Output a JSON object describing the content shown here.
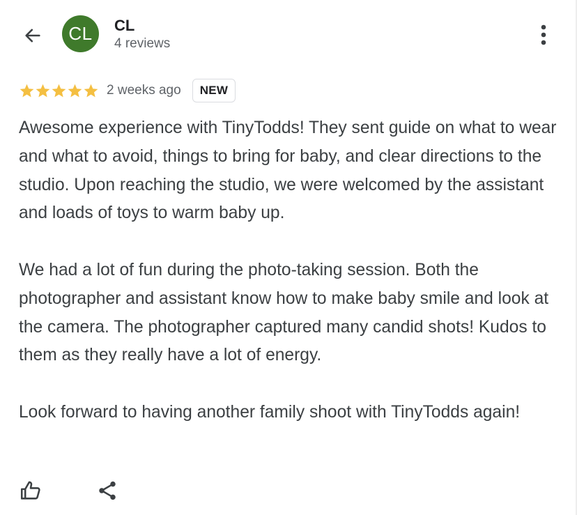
{
  "header": {
    "back_icon": "arrow-left-icon",
    "avatar_initials": "CL",
    "reviewer_name": "CL",
    "review_count": "4 reviews",
    "more_icon": "more-vertical-icon"
  },
  "review": {
    "rating": 5,
    "rating_max": 5,
    "date": "2 weeks ago",
    "badge": "NEW",
    "paragraphs": [
      "Awesome experience with TinyTodds! They sent guide on what to wear and what to avoid, things to bring for baby, and clear directions to the studio. Upon reaching the studio, we were welcomed by the assistant and loads of toys to warm baby up.",
      "We had a lot of fun during the photo-taking session. Both the photographer and assistant know how to make baby smile and look at the camera. The photographer captured many candid shots! Kudos to them as they really have a lot of energy.",
      "Look forward to having another family shoot with TinyTodds again!"
    ]
  },
  "actions": {
    "like_icon": "thumbs-up-icon",
    "share_icon": "share-icon"
  },
  "colors": {
    "avatar_bg": "#3f7a2b",
    "star": "#f4bf42",
    "text": "#3c4043",
    "muted": "#5f6368"
  }
}
